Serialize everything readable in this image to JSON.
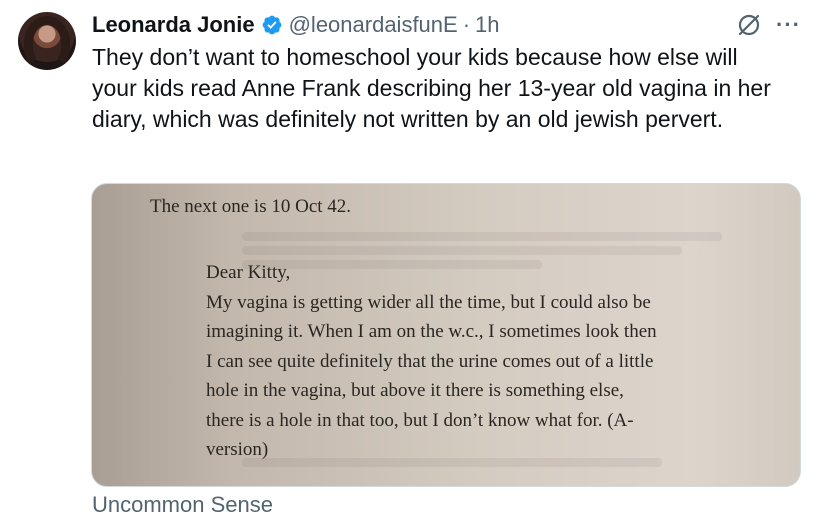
{
  "author": {
    "name": "Leonarda Jonie",
    "handle": "@leonardaisfunE",
    "separator": "·",
    "time": "1h",
    "verified_color": "#1d9bf0"
  },
  "actions": {
    "grok_icon": "slash-circle-icon",
    "more_label": "···"
  },
  "tweet": {
    "text": "They don’t want to homeschool your kids because how else will your kids read Anne Frank describing her 13-year old vagina in her diary, which was definitely not written by an old jewish pervert."
  },
  "media": {
    "intro": "The next one is 10 Oct 42.",
    "lines": [
      "Dear Kitty,",
      "My vagina is getting wider all the time, but I could also be",
      "imagining it. When I am on the w.c., I sometimes look then",
      "I can see quite definitely that the urine comes out of a little",
      "hole in the vagina, but above it there is something else,",
      "there is a hole in that too, but I don’t know what for. (A-",
      "version)"
    ]
  },
  "caption": "Uncommon Sense"
}
